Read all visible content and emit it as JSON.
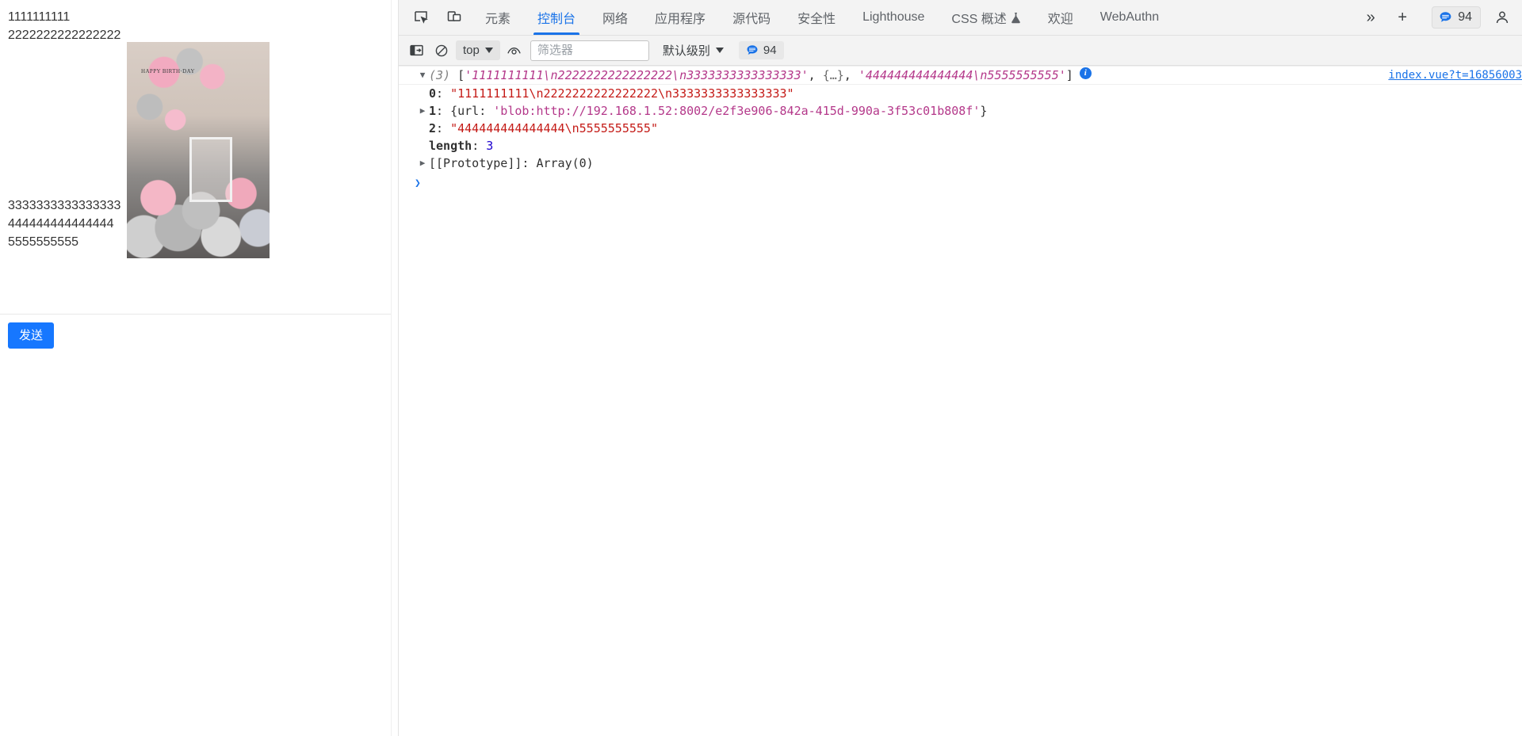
{
  "page": {
    "message": {
      "lines_top": [
        "1111111111",
        "2222222222222222"
      ],
      "lines_bottom": [
        "3333333333333333",
        "444444444444444",
        "5555555555"
      ],
      "image_alt": "balloon-arch-photo",
      "image_caption": "HAPPY BIRTH·DAY"
    },
    "composer": {
      "send_label": "发送"
    }
  },
  "devtools": {
    "icons": {
      "inspect": "inspect-element-icon",
      "device": "device-toolbar-icon",
      "more": "more-tabs-icon",
      "add": "add-panel-icon",
      "avatar": "account-icon"
    },
    "tabs": [
      {
        "label": "元素",
        "active": false,
        "badge": ""
      },
      {
        "label": "控制台",
        "active": true,
        "badge": ""
      },
      {
        "label": "网络",
        "active": false,
        "badge": ""
      },
      {
        "label": "应用程序",
        "active": false,
        "badge": ""
      },
      {
        "label": "源代码",
        "active": false,
        "badge": ""
      },
      {
        "label": "安全性",
        "active": false,
        "badge": ""
      },
      {
        "label": "Lighthouse",
        "active": false,
        "badge": ""
      },
      {
        "label": "CSS 概述",
        "active": false,
        "badge": "flask"
      },
      {
        "label": "欢迎",
        "active": false,
        "badge": ""
      },
      {
        "label": "WebAuthn",
        "active": false,
        "badge": ""
      }
    ],
    "more_tabs_label": "»",
    "add_tab_label": "+",
    "issues": {
      "count": "94",
      "icon": "message-bubble-icon"
    },
    "console_toolbar": {
      "sidebar_icon": "console-sidebar-icon",
      "clear_icon": "clear-console-icon",
      "context_value": "top",
      "eye_icon": "live-expression-icon",
      "filter_placeholder": "筛选器",
      "filter_value": "",
      "level_value": "默认级别",
      "badge_count": "94",
      "badge_icon": "message-bubble-icon"
    },
    "console_rows": {
      "header": {
        "twisty": "▼",
        "count": "(3)",
        "open_bracket": "[",
        "item0": "'1111111111\\n2222222222222222\\n3333333333333333'",
        "sep1": ", ",
        "item1": "{…}",
        "sep2": ", ",
        "item2": "'444444444444444\\n5555555555'",
        "close_bracket": "]",
        "info_icon": "info-icon",
        "source": "index.vue?t=16856003"
      },
      "entries": [
        {
          "twisty": "",
          "key": "0",
          "colon": ": ",
          "value": "\"1111111111\\n2222222222222222\\n3333333333333333\"",
          "value_kind": "string"
        },
        {
          "twisty": "▶",
          "key": "1",
          "colon": ": ",
          "value_prefix": "{url: ",
          "value_url": "'blob:http://192.168.1.52:8002/e2f3e906-842a-415d-990a-3f53c01b808f'",
          "value_suffix": "}",
          "value_kind": "object"
        },
        {
          "twisty": "",
          "key": "2",
          "colon": ": ",
          "value": "\"444444444444444\\n5555555555\"",
          "value_kind": "string"
        },
        {
          "twisty": "",
          "key": "length",
          "colon": ": ",
          "value": "3",
          "value_kind": "number"
        },
        {
          "twisty": "▶",
          "key": "[[Prototype]]",
          "colon": ": ",
          "value": "Array(0)",
          "value_kind": "proto"
        }
      ],
      "prompt_arrow": "❯"
    }
  },
  "colors": {
    "accent": "#1a73e8",
    "send_button": "#1677ff",
    "string": "#c41a16",
    "string_pink": "#b4388a",
    "number": "#1c00cf",
    "toolbar_bg": "#f3f3f3"
  }
}
